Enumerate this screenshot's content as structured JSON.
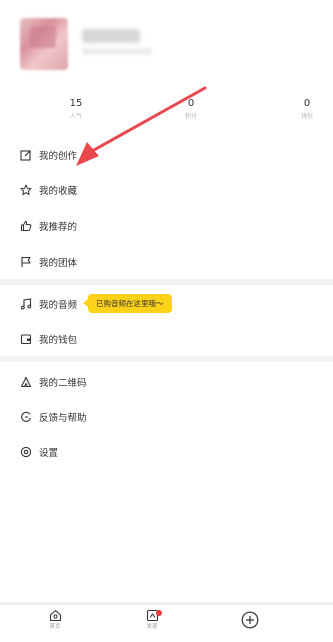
{
  "profile": {
    "stats": [
      {
        "value": "15",
        "label": "人气"
      },
      {
        "value": "0",
        "label": "积分"
      },
      {
        "value": "0",
        "label": "钱包"
      }
    ]
  },
  "menu": {
    "section1": [
      {
        "label": "我的创作",
        "icon": "edit-icon"
      },
      {
        "label": "我的收藏",
        "icon": "star-icon"
      },
      {
        "label": "我推荐的",
        "icon": "thumbs-up-icon"
      },
      {
        "label": "我的团体",
        "icon": "flag-icon"
      }
    ],
    "section2": [
      {
        "label": "我的音频",
        "icon": "music-icon"
      },
      {
        "label": "我的钱包",
        "icon": "wallet-icon"
      }
    ],
    "section3": [
      {
        "label": "我的二维码",
        "icon": "qr-code-icon"
      },
      {
        "label": "反馈与帮助",
        "icon": "feedback-icon"
      },
      {
        "label": "设置",
        "icon": "settings-icon"
      }
    ]
  },
  "tooltip": {
    "text": "已购音频在这里哦～"
  },
  "bottom_nav": [
    {
      "label": "首页",
      "icon": "home-icon"
    },
    {
      "label": "发现",
      "icon": "discover-icon"
    },
    {
      "label": "",
      "icon": "plus-circle-icon"
    }
  ],
  "colors": {
    "accent": "#ffd21a",
    "annotation_arrow": "#e8474e",
    "badge": "#f0393a"
  }
}
